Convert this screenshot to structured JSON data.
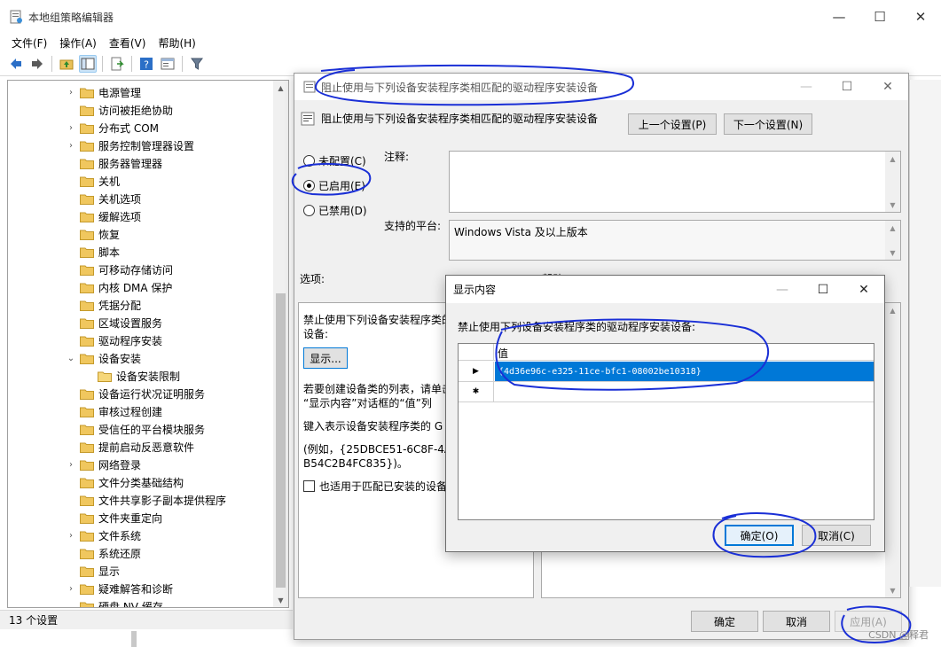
{
  "main_window": {
    "title": "本地组策略编辑器",
    "controls": {
      "minimize": "—",
      "maximize": "☐",
      "close": "✕"
    },
    "menu": [
      "文件(F)",
      "操作(A)",
      "查看(V)",
      "帮助(H)"
    ],
    "status": "13 个设置"
  },
  "tree": {
    "items": [
      {
        "label": "电源管理",
        "chevron": "›"
      },
      {
        "label": "访问被拒绝协助",
        "chevron": ""
      },
      {
        "label": "分布式 COM",
        "chevron": "›"
      },
      {
        "label": "服务控制管理器设置",
        "chevron": "›"
      },
      {
        "label": "服务器管理器",
        "chevron": ""
      },
      {
        "label": "关机",
        "chevron": ""
      },
      {
        "label": "关机选项",
        "chevron": ""
      },
      {
        "label": "缓解选项",
        "chevron": ""
      },
      {
        "label": "恢复",
        "chevron": ""
      },
      {
        "label": "脚本",
        "chevron": ""
      },
      {
        "label": "可移动存储访问",
        "chevron": ""
      },
      {
        "label": "内核 DMA 保护",
        "chevron": ""
      },
      {
        "label": "凭据分配",
        "chevron": ""
      },
      {
        "label": "区域设置服务",
        "chevron": ""
      },
      {
        "label": "驱动程序安装",
        "chevron": ""
      },
      {
        "label": "设备安装",
        "chevron": "⌄"
      },
      {
        "label": "设备安装限制",
        "chevron": "",
        "child": true
      },
      {
        "label": "设备运行状况证明服务",
        "chevron": ""
      },
      {
        "label": "审核过程创建",
        "chevron": ""
      },
      {
        "label": "受信任的平台模块服务",
        "chevron": ""
      },
      {
        "label": "提前启动反恶意软件",
        "chevron": ""
      },
      {
        "label": "网络登录",
        "chevron": "›"
      },
      {
        "label": "文件分类基础结构",
        "chevron": ""
      },
      {
        "label": "文件共享影子副本提供程序",
        "chevron": ""
      },
      {
        "label": "文件夹重定向",
        "chevron": ""
      },
      {
        "label": "文件系统",
        "chevron": "›"
      },
      {
        "label": "系统还原",
        "chevron": ""
      },
      {
        "label": "显示",
        "chevron": ""
      },
      {
        "label": "疑难解答和诊断",
        "chevron": "›"
      },
      {
        "label": "硬盘 NV 缓存",
        "chevron": ""
      }
    ]
  },
  "policy_dialog": {
    "title": "阻止使用与下列设备安装程序类相匹配的驱动程序安装设备",
    "heading": "阻止使用与下列设备安装程序类相匹配的驱动程序安装设备",
    "prev_button": "上一个设置(P)",
    "next_button": "下一个设置(N)",
    "radio_not_configured": "未配置(C)",
    "radio_enabled": "已启用(E)",
    "radio_disabled": "已禁用(D)",
    "comment_label": "注释:",
    "platform_label": "支持的平台:",
    "platform_value": "Windows Vista 及以上版本",
    "options_label": "选项:",
    "help_label": "帮助:",
    "options_text1": "禁止使用下列设备安装程序类的",
    "options_text1b": "设备:",
    "show_button": "显示...",
    "options_text2": "若要创建设备类的列表，请单击",
    "options_text2b": "“显示内容”对话框的“值”列",
    "options_text3": "键入表示设备安装程序类的 G",
    "options_text4": "(例如，{25DBCE51-6C8F-4A7",
    "options_text4b": "B54C2B4FC835})。",
    "checkbox_label": "也适用于匹配已安装的设备。",
    "ok_button": "确定",
    "cancel_button": "取消",
    "apply_button": "应用(A)"
  },
  "show_dialog": {
    "title": "显示内容",
    "description": "禁止使用下列设备安装程序类的驱动程序安装设备:",
    "column_header": "值",
    "rows": [
      {
        "marker": "▶",
        "value": "{4d36e96c-e325-11ce-bfc1-08002be10318}"
      },
      {
        "marker": "✱",
        "value": ""
      }
    ],
    "ok_button": "确定(O)",
    "cancel_button": "取消(C)"
  },
  "watermark": "CSDN @释君",
  "colors": {
    "selection": "#0078d7",
    "annotation": "#1a2fd6"
  }
}
